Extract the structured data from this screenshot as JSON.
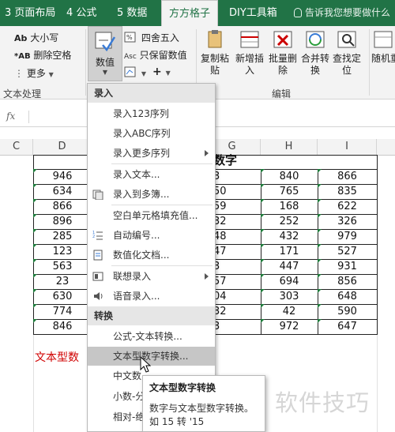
{
  "tabs": [
    {
      "label": "3 页面布局"
    },
    {
      "label": "4 公式"
    },
    {
      "label": "5 数据"
    },
    {
      "label": "方方格子"
    },
    {
      "label": "DIY工具箱"
    }
  ],
  "tell_me": "告诉我您想要做什么",
  "ribbon": {
    "case_btn": "大小写",
    "delete_space_btn": "删除空格",
    "more_btn": "更多",
    "text_group": "文本处理",
    "number_btn": "数值",
    "round_btn": "四舍五入",
    "keep_value_btn": "只保留数值",
    "plus_btn": "+",
    "copy_paste_btn": "复制粘贴",
    "add_insert_btn": "新增插入",
    "batch_delete_btn": "批量删除",
    "merge_convert_btn": "合并转换",
    "find_locate_btn": "查找定位",
    "random_btn": "随机重",
    "edit_group": "编辑"
  },
  "formula_bar": {
    "fx": "fx"
  },
  "columns": [
    "C",
    "D",
    "G",
    "H",
    "I"
  ],
  "table_title": "数字",
  "col_d": [
    "946",
    "634",
    "866",
    "896",
    "285",
    "123",
    "563",
    "23",
    "630",
    "774",
    "846"
  ],
  "col_g": [
    "3",
    "50",
    "59",
    "32",
    "48",
    "47",
    "3",
    "57",
    "04",
    "32",
    "3"
  ],
  "col_h": [
    "840",
    "765",
    "168",
    "252",
    "432",
    "171",
    "447",
    "694",
    "303",
    "42",
    "972"
  ],
  "col_i": [
    "866",
    "835",
    "622",
    "326",
    "979",
    "527",
    "931",
    "856",
    "648",
    "590",
    "647"
  ],
  "red_text": "文本型数",
  "menu": {
    "section1": "录入",
    "items1": [
      "录入123序列",
      "录入ABC序列",
      "录入更多序列"
    ],
    "items2": [
      "录入文本...",
      "录入到多簿..."
    ],
    "items3": [
      "空白单元格填充值...",
      "自动编号...",
      "数值化文档..."
    ],
    "items4": [
      "联想录入",
      "语音录入..."
    ],
    "section2": "转换",
    "items5": [
      "公式-文本转换...",
      "文本型数字转换...",
      "中文数",
      "小数-分",
      "相对-绝"
    ]
  },
  "tooltip": {
    "title": "文本型数字转换",
    "line1": "数字与文本型数字转换。",
    "line2": "如 15 转 '15"
  },
  "watermark": "软件技巧",
  "colors": {
    "excel_green": "#217346",
    "menu_highlight": "#c6c6c6",
    "red_text": "#d00000"
  }
}
